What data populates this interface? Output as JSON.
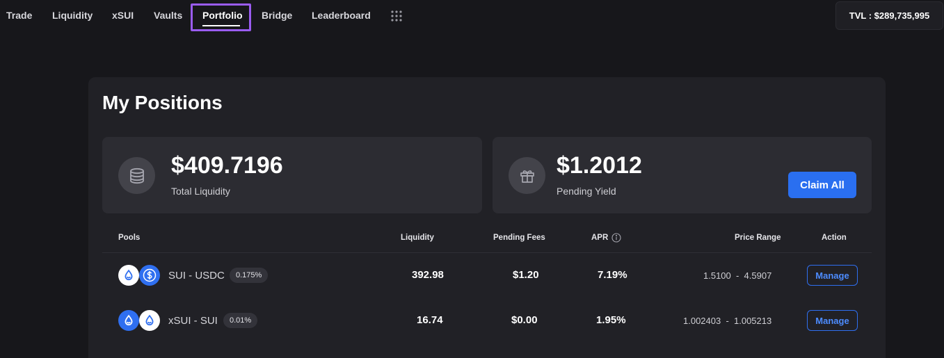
{
  "nav": {
    "items": [
      "Trade",
      "Liquidity",
      "xSUI",
      "Vaults",
      "Portfolio",
      "Bridge",
      "Leaderboard"
    ],
    "active": "Portfolio",
    "tvl": "TVL : $289,735,995"
  },
  "page": {
    "title": "My Positions"
  },
  "stats": {
    "liquidity": {
      "value": "$409.7196",
      "label": "Total Liquidity",
      "icon": "coins-stack-icon"
    },
    "yield": {
      "value": "$1.2012",
      "label": "Pending Yield",
      "icon": "gift-icon",
      "claim_label": "Claim All"
    }
  },
  "table": {
    "headers": {
      "pools": "Pools",
      "liquidity": "Liquidity",
      "pending_fees": "Pending Fees",
      "apr": "APR",
      "price_range": "Price Range",
      "action": "Action"
    },
    "rows": [
      {
        "pair": "SUI - USDC",
        "tokens": [
          "sui-icon",
          "usdc-icon"
        ],
        "fee": "0.175%",
        "liquidity": "392.98",
        "pending_fees": "$1.20",
        "apr": "7.19%",
        "price_range": "1.5100  -  4.5907",
        "action": "Manage"
      },
      {
        "pair": "xSUI - SUI",
        "tokens": [
          "xsui-icon",
          "sui-icon"
        ],
        "fee": "0.01%",
        "liquidity": "16.74",
        "pending_fees": "$0.00",
        "apr": "1.95%",
        "price_range": "1.002403  -  1.005213",
        "action": "Manage"
      }
    ]
  },
  "colors": {
    "background": "#17171b",
    "card": "#212126",
    "stat_card": "#2c2c32",
    "accent_blue": "#2a6ff0",
    "active_outline": "#9a5cf0"
  }
}
